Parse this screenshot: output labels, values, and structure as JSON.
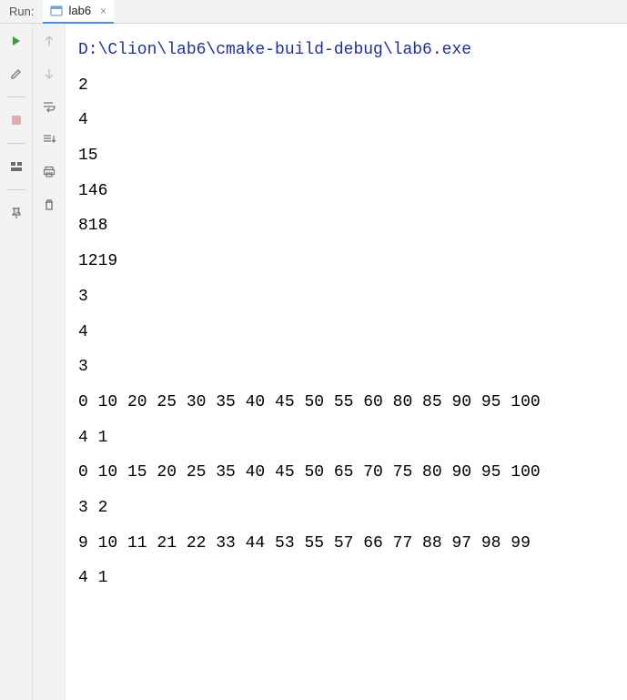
{
  "header": {
    "run_label": "Run:",
    "tab": {
      "name": "lab6",
      "close": "×"
    }
  },
  "console": {
    "command": "D:\\Clion\\lab6\\cmake-build-debug\\lab6.exe",
    "lines": [
      "2",
      "4",
      "15",
      "146",
      "818",
      "1219",
      "3",
      "4",
      "3",
      "0 10 20 25 30 35 40 45 50 55 60 80 85 90 95 100",
      "4 1",
      "0 10 15 20 25 35 40 45 50 65 70 75 80 90 95 100",
      "3 2",
      "9 10 11 21 22 33 44 53 55 57 66 77 88 97 98 99",
      "4 1"
    ]
  }
}
